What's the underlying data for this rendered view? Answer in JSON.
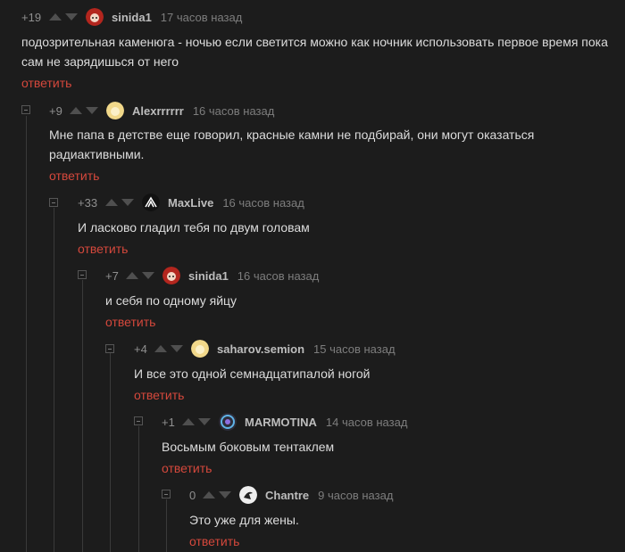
{
  "comments": [
    {
      "rating": "+19",
      "author": "sinida1",
      "time": "17 часов назад",
      "text": "подозрительная каменюга - ночью если светится  можно как ночник использовать первое время пока сам не зарядишься от него",
      "reply": "ответить",
      "avatar": "red-anime-avatar"
    },
    {
      "rating": "+9",
      "author": "Alexrrrrrr",
      "time": "16 часов назад",
      "text": "Мне папа в детстве еще говорил, красные камни не подбирай, они могут оказаться радиактивными.",
      "reply": "ответить",
      "avatar": "yellow-avatar"
    },
    {
      "rating": "+33",
      "author": "MaxLive",
      "time": "16 часов назад",
      "text": "И ласково гладил тебя по двум головам",
      "reply": "ответить",
      "avatar": "black-white-logo-avatar"
    },
    {
      "rating": "+7",
      "author": "sinida1",
      "time": "16 часов назад",
      "text": "и себя по одному яйцу",
      "reply": "ответить",
      "avatar": "red-anime-avatar"
    },
    {
      "rating": "+4",
      "author": "saharov.semion",
      "time": "15 часов назад",
      "text": "И все это одной семнадцатипалой ногой",
      "reply": "ответить",
      "avatar": "yellow-avatar"
    },
    {
      "rating": "+1",
      "author": "MARMOTINA",
      "time": "14 часов назад",
      "text": "Восьмым боковым тентаклем",
      "reply": "ответить",
      "avatar": "blue-circle-avatar"
    },
    {
      "rating": "0",
      "author": "Chantre",
      "time": "9 часов назад",
      "text": "Это уже для жены.",
      "reply": "ответить",
      "avatar": "white-bird-avatar"
    }
  ],
  "colors": {
    "background": "#1c1c1c",
    "reply": "#d5483c",
    "text": "#dcdcdc"
  }
}
